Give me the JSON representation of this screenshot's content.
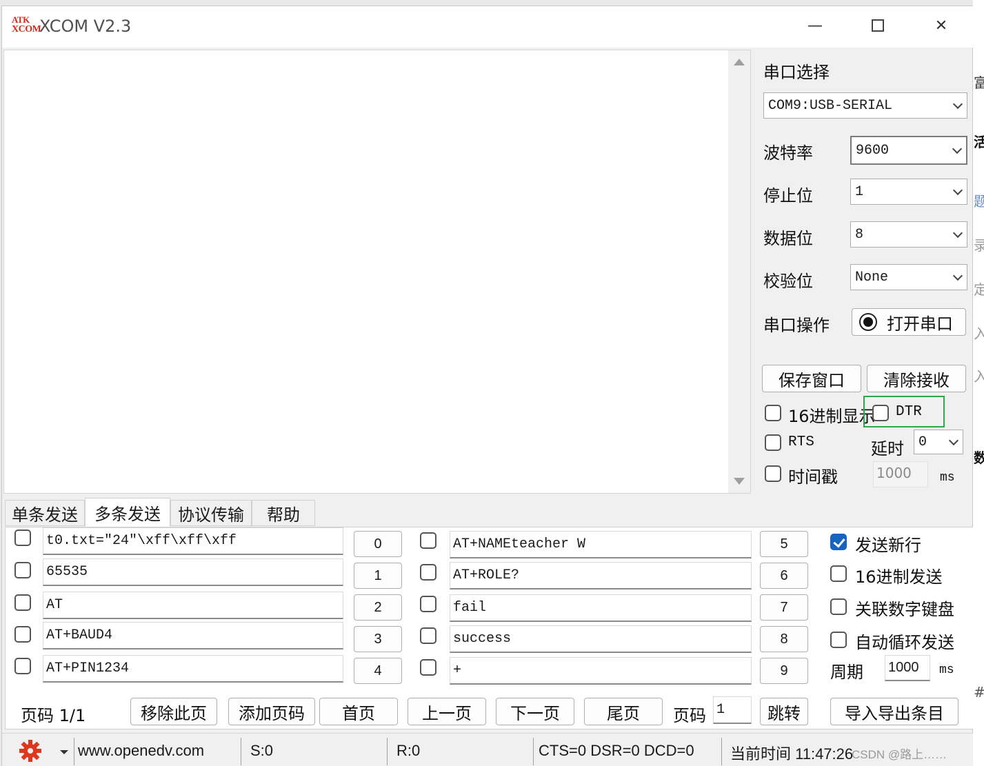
{
  "window": {
    "logo_line1": "ATK",
    "logo_line2": "XCOM",
    "title": "XCOM V2.3",
    "minimize_glyph": "—",
    "maximize_glyph": "☐",
    "close_glyph": "✕"
  },
  "serial": {
    "port_label": "串口选择",
    "port_value": "COM9:USB-SERIAL",
    "baud_label": "波特率",
    "baud_value": "9600",
    "stopbits_label": "停止位",
    "stopbits_value": "1",
    "databits_label": "数据位",
    "databits_value": "8",
    "parity_label": "校验位",
    "parity_value": "None",
    "op_label": "串口操作",
    "open_button": "打开串口",
    "save_window": "保存窗口",
    "clear_recv": "清除接收",
    "hex_display": "16进制显示",
    "dtr": "DTR",
    "rts": "RTS",
    "delay_label": "延时",
    "delay_value": "0",
    "timestamp": "时间戳",
    "timestamp_value": "1000",
    "timestamp_unit": "ms"
  },
  "tabs": [
    "单条发送",
    "多条发送",
    "协议传输",
    "帮助"
  ],
  "multi_send": {
    "left_rows": [
      {
        "text": "t0.txt=\"24\"\\xff\\xff\\xff",
        "num": "0"
      },
      {
        "text": "65535",
        "num": "1"
      },
      {
        "text": "AT",
        "num": "2"
      },
      {
        "text": "AT+BAUD4",
        "num": "3"
      },
      {
        "text": "AT+PIN1234",
        "num": "4"
      }
    ],
    "right_rows": [
      {
        "text": "AT+NAMEteacher W",
        "num": "5"
      },
      {
        "text": "AT+ROLE?",
        "num": "6"
      },
      {
        "text": "fail",
        "num": "7"
      },
      {
        "text": "success",
        "num": "8"
      },
      {
        "text": "+",
        "num": "9"
      }
    ],
    "options": {
      "send_newline": "发送新行",
      "hex_send": "16进制发送",
      "link_keypad": "关联数字键盘",
      "auto_loop": "自动循环发送",
      "period_label": "周期",
      "period_value": "1000",
      "period_unit": "ms"
    },
    "page_label": "页码 1/1",
    "remove_page": "移除此页",
    "add_page": "添加页码",
    "first_page": "首页",
    "prev_page": "上一页",
    "next_page": "下一页",
    "last_page": "尾页",
    "goto_label": "页码",
    "goto_value": "1",
    "jump": "跳转",
    "import_export": "导入导出条目"
  },
  "status": {
    "website": "www.openedv.com",
    "sent": "S:0",
    "received": "R:0",
    "lines": "CTS=0 DSR=0 DCD=0",
    "time": "当前时间 11:47:26",
    "watermark": "CSDN @路上……"
  },
  "icons": {
    "settings": "gear-icon",
    "dropdown": "chevron-down-icon"
  },
  "colors": {
    "highlight_box": "#2aa84a",
    "checkbox_checked": "#1764c0",
    "logo_red": "#d8261b"
  },
  "background_window_chars": [
    "富",
    "活",
    "题",
    "录",
    "定",
    "入",
    "入",
    "数",
    "#"
  ]
}
